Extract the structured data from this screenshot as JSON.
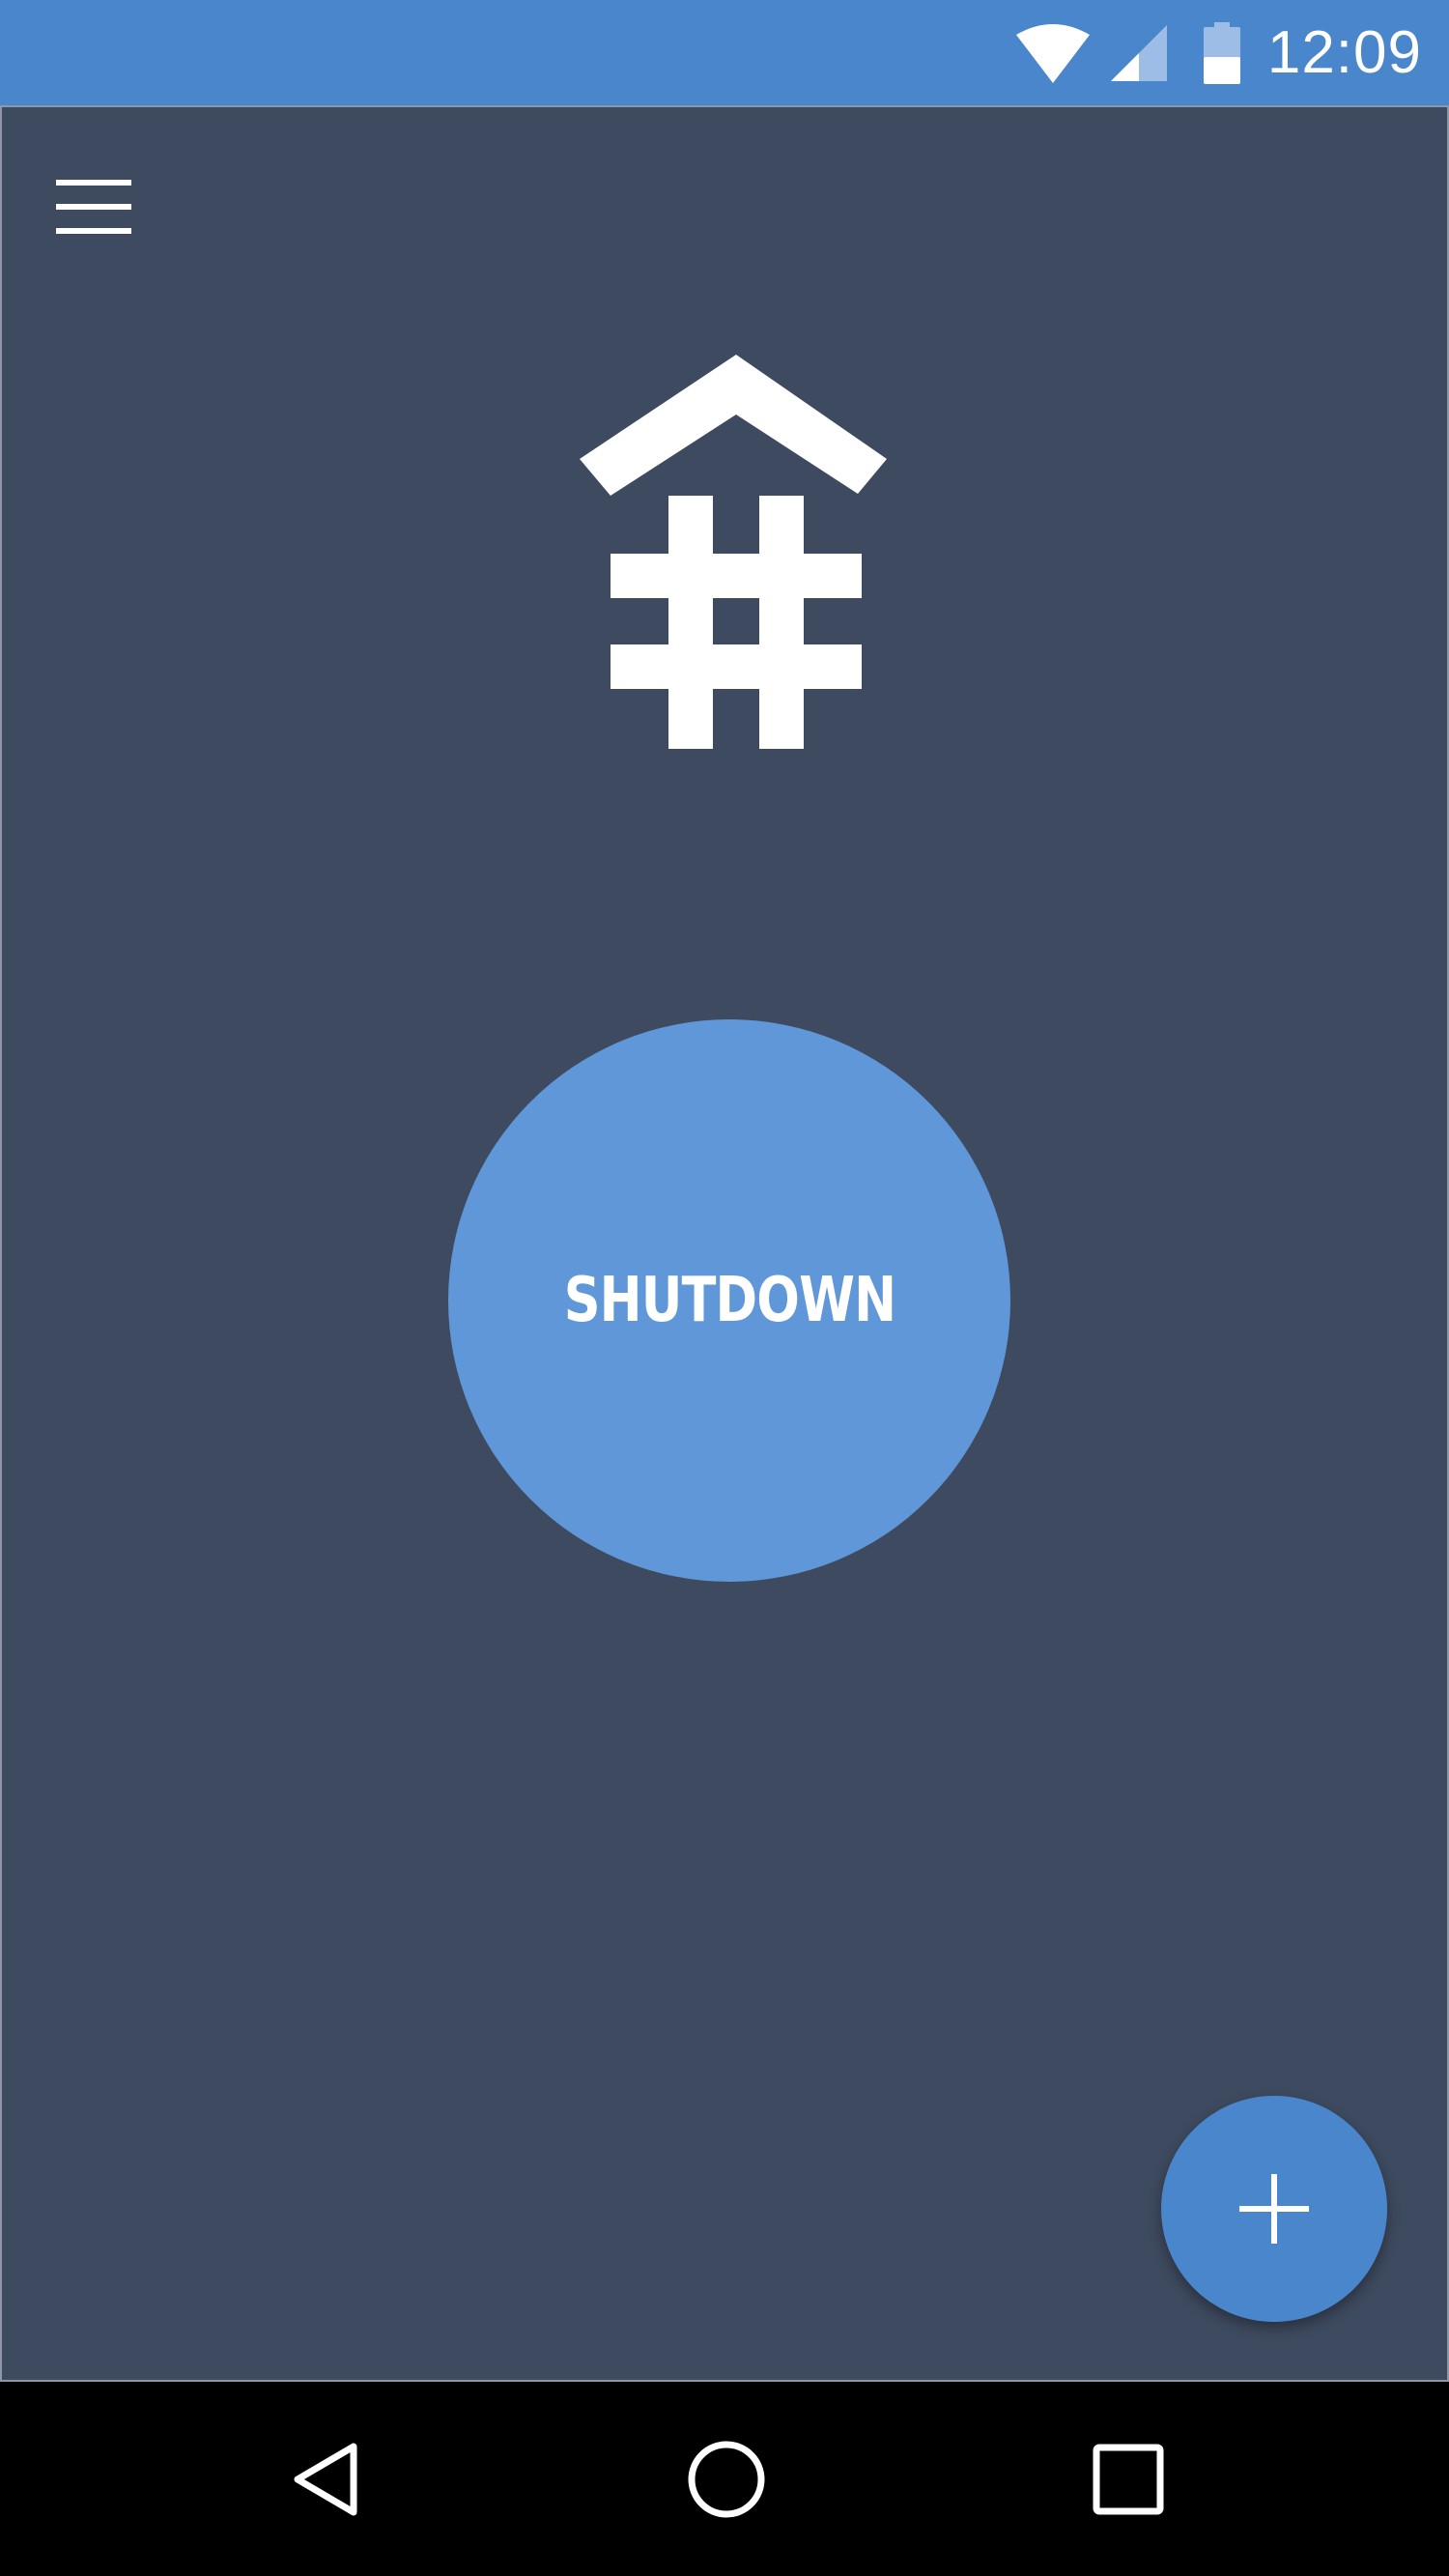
{
  "status_bar": {
    "time": "12:09",
    "icons": [
      "wifi-icon",
      "cell-signal-icon",
      "battery-icon"
    ],
    "color": "#4a86cc"
  },
  "app": {
    "background": "#3e4a5f",
    "menu_icon": "hamburger-menu-icon",
    "logo_icon": "roof-hash-logo-icon",
    "shutdown_button": {
      "label": "SHUTDOWN",
      "color": "#6097d8"
    },
    "fab": {
      "icon": "plus-icon",
      "color": "#4a86cc"
    }
  },
  "nav_bar": {
    "buttons": [
      "back-icon",
      "home-icon",
      "recents-icon"
    ]
  }
}
